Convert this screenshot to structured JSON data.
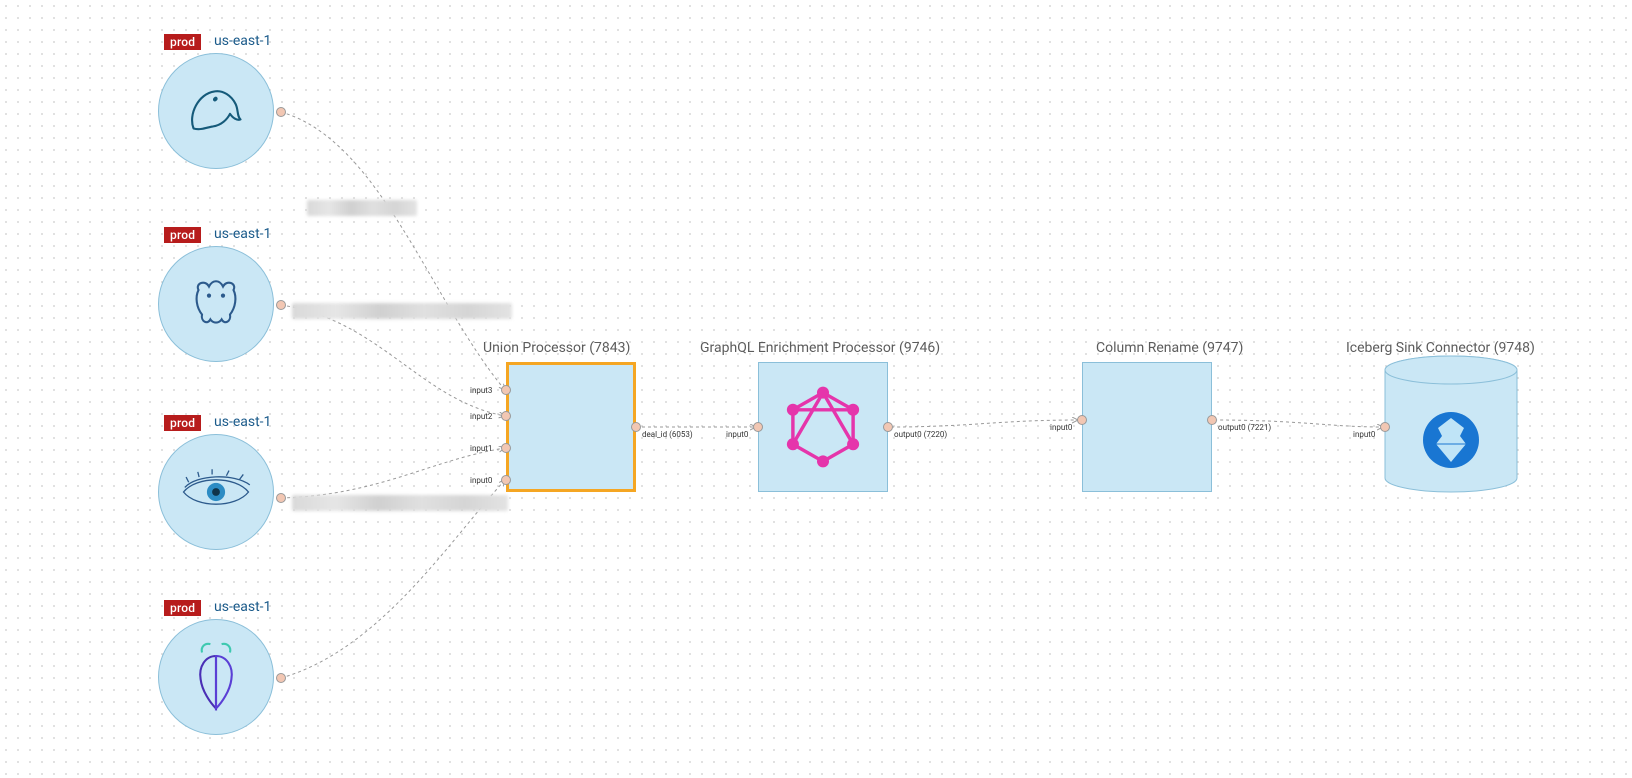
{
  "sources": [
    {
      "env": "prod",
      "region": "us-east-1",
      "icon": "mysql"
    },
    {
      "env": "prod",
      "region": "us-east-1",
      "icon": "postgres"
    },
    {
      "env": "prod",
      "region": "us-east-1",
      "icon": "cassandra-eye"
    },
    {
      "env": "prod",
      "region": "us-east-1",
      "icon": "cockroach"
    }
  ],
  "processors": {
    "union": {
      "label": "Union Processor (7843)",
      "selected": true,
      "inputs": [
        "input3",
        "input2",
        "input1",
        "input0"
      ],
      "output_label": "deal_id (6053)"
    },
    "graphql": {
      "label": "GraphQL Enrichment Processor (9746)",
      "input_label": "input0",
      "output_label": "output0 (7220)"
    },
    "rename": {
      "label": "Column Rename (9747)",
      "input_label": "input0",
      "output_label": "output0 (7221)"
    }
  },
  "sink": {
    "label": "Iceberg Sink Connector (9748)",
    "input_label": "input0"
  }
}
